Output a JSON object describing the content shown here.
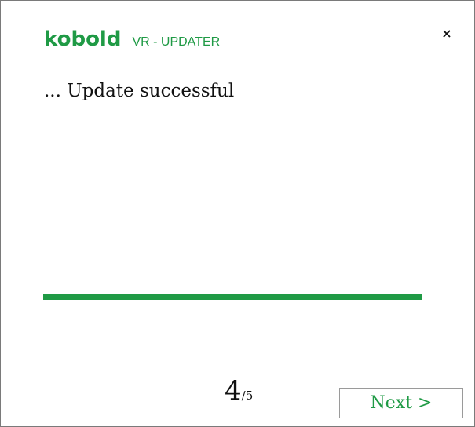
{
  "header": {
    "logo_text": "kobold",
    "product_name": "VR - UPDATER",
    "close_glyph": "×"
  },
  "main": {
    "status_text": "... Update successful",
    "progress_fraction": 1.0
  },
  "footer": {
    "step_current": "4",
    "step_total_text": "/5",
    "next_label": "Next >"
  },
  "colors": {
    "brand_green": "#1f9a45",
    "text": "#111111",
    "border": "#7a7a7a"
  },
  "icons": {
    "close": "close-icon"
  }
}
